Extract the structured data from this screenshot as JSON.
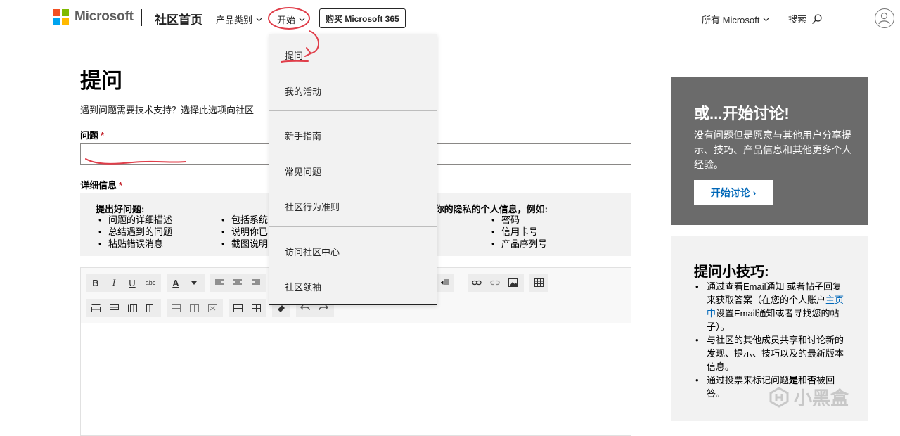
{
  "header": {
    "brand": "Microsoft",
    "home": "社区首页",
    "categories": "产品类别",
    "start": "开始",
    "buy": "购买 Microsoft 365",
    "all_microsoft": "所有 Microsoft",
    "search": "搜索"
  },
  "dropdown": {
    "items": [
      "提问",
      "我的活动",
      "新手指南",
      "常见问题",
      "社区行为准则",
      "访问社区中心",
      "社区领袖"
    ]
  },
  "main": {
    "title": "提问",
    "description": "遇到问题需要技术支持？选择此选项向社区",
    "question_label": "问题",
    "details_label": "详细信息",
    "required_mark": "*",
    "tips": {
      "good_heading": "提出好问题:",
      "col1": [
        "问题的详细描述",
        "总结遇到的问题",
        "粘贴错误消息"
      ],
      "col2": [
        "包括系统",
        "说明你已",
        "截图说明"
      ],
      "privacy_heading": "E你的隐私的个人信息，例如:",
      "col3": [
        "密码",
        "信用卡号",
        "产品序列号"
      ]
    }
  },
  "editor": {
    "bold": "B",
    "italic": "I",
    "underline": "U",
    "strike": "abc",
    "font_color": "A"
  },
  "discussion_card": {
    "title": "或...开始讨论!",
    "description": "没有问题但是愿意与其他用户分享提示、技巧、产品信息和其他更多个人经验。",
    "button": "开始讨论 ›"
  },
  "tips_card": {
    "title": "提问小技巧:",
    "item1_pre": "通过查看Email通知 或者帖子回复来获取答案（在您的个人账户",
    "item1_link": "主页中",
    "item1_post": "设置Email通知或者寻找您的帖子）。",
    "item2": "与社区的其他成员共享和讨论新的发现、提示、技巧以及的最新版本信息。",
    "item3_pre": "通过投票来标记问题",
    "item3_yes": "是",
    "item3_mid": "和",
    "item3_no": "否",
    "item3_post": "被回答。"
  },
  "watermark": "小黑盒",
  "colors": {
    "accent_blue": "#0067b8",
    "annotation_red": "#e03e4a",
    "dark_card": "#6b6b6b",
    "light_bg": "#f2f2f2"
  }
}
